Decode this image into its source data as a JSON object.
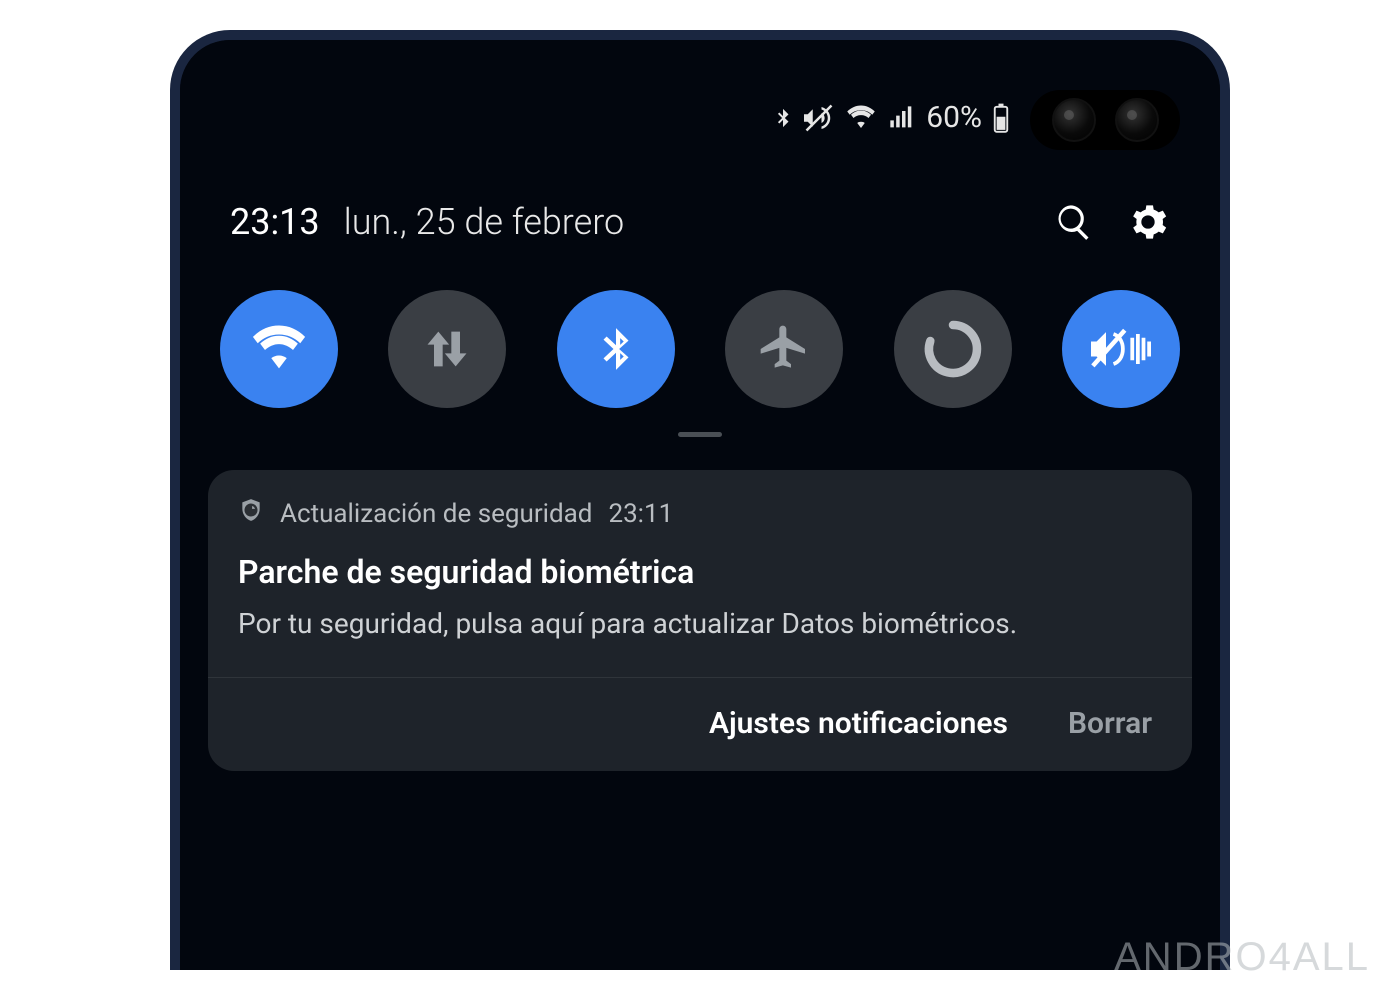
{
  "status_bar": {
    "battery_text": "60%",
    "icons": [
      "bluetooth",
      "vibrate-mute",
      "wifi",
      "signal"
    ]
  },
  "header": {
    "time": "23:13",
    "date": "lun., 25 de febrero"
  },
  "quick_toggles": [
    {
      "name": "wifi",
      "active": true
    },
    {
      "name": "mobile-data",
      "active": false
    },
    {
      "name": "bluetooth",
      "active": true
    },
    {
      "name": "airplane",
      "active": false
    },
    {
      "name": "rotate",
      "active": false
    },
    {
      "name": "sound-vibrate",
      "active": true
    }
  ],
  "notification": {
    "app_name": "Actualización de seguridad",
    "time": "23:11",
    "title": "Parche de seguridad biométrica",
    "body": "Por tu seguridad, pulsa aquí para actualizar Datos biométricos.",
    "action_settings": "Ajustes notificaciones",
    "action_clear": "Borrar"
  },
  "watermark": "andro4all"
}
